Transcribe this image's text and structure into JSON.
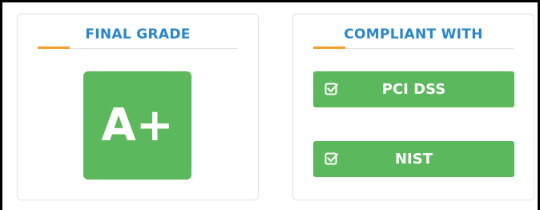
{
  "final_grade": {
    "title": "FINAL GRADE",
    "grade": "A+"
  },
  "compliance": {
    "title": "COMPLIANT WITH",
    "items": [
      {
        "label": "PCI DSS",
        "icon": "checkbox-checked-icon"
      },
      {
        "label": "NIST",
        "icon": "checkbox-checked-icon"
      }
    ]
  },
  "colors": {
    "accent_blue": "#2a86c7",
    "accent_orange": "#f0a030",
    "success_green": "#5cb85c"
  }
}
